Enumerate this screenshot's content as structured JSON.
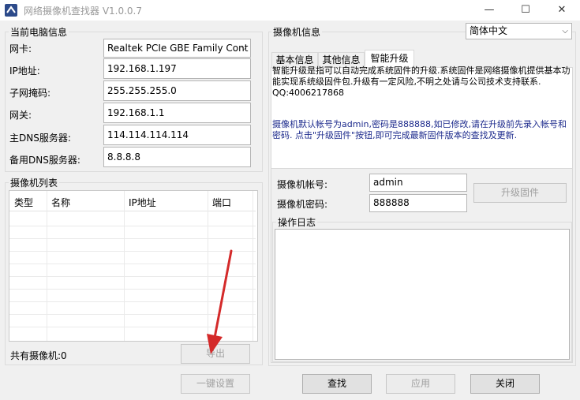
{
  "window": {
    "title": "网络摄像机查找器 V1.0.0.7",
    "minimize_label": "—",
    "maximize_label": "☐",
    "close_label": "✕"
  },
  "pc_info": {
    "group_title": "当前电脑信息",
    "nic_label": "网卡:",
    "nic_value": "Realtek PCIe GBE Family Cont",
    "ip_label": "IP地址:",
    "ip_value": "192.168.1.197",
    "mask_label": "子网掩码:",
    "mask_value": "255.255.255.0",
    "gateway_label": "网关:",
    "gateway_value": "192.168.1.1",
    "dns1_label": "主DNS服务器:",
    "dns1_value": "114.114.114.114",
    "dns2_label": "备用DNS服务器:",
    "dns2_value": "8.8.8.8"
  },
  "camera_list": {
    "group_title": "摄像机列表",
    "columns": [
      "类型",
      "名称",
      "IP地址",
      "端口"
    ],
    "count_label": "共有摄像机:0",
    "export_label": "导出"
  },
  "camera_info": {
    "group_title": "摄像机信息",
    "language_value": "简体中文",
    "tabs": [
      "基本信息",
      "其他信息",
      "智能升级"
    ],
    "active_tab": "智能升级",
    "upgrade_desc": "    智能升级是指可以自动完成系统固件的升级.系统固件是网络摄像机提供基本功能实现系统级固件包.升级有一定风险,不明之处请与公司技术支持联系. QQ:4006217868",
    "upgrade_note": "    摄像机默认帐号为admin,密码是888888,如已修改,请在升级前先录入帐号和密码. 点击\"升级固件\"按钮,即可完成最新固件版本的查找及更新.",
    "account_label": "摄像机帐号:",
    "account_value": "admin",
    "password_label": "摄像机密码:",
    "password_value": "888888",
    "upgrade_button": "升级固件",
    "log_title": "操作日志"
  },
  "bottom": {
    "one_key_label": "一键设置",
    "find_label": "查找",
    "apply_label": "应用",
    "close_label": "关闭"
  },
  "colors": {
    "annotation_arrow": "#d42a2a",
    "info_blue": "#1c2a8c"
  }
}
